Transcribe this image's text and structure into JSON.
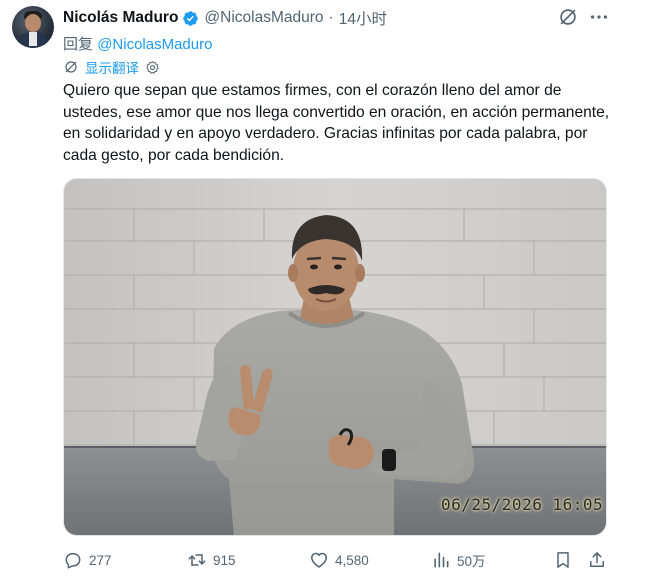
{
  "author": {
    "name": "Nicolás Maduro",
    "handle": "@NicolasMaduro",
    "separator": "·",
    "time": "14小时"
  },
  "reply": {
    "prefix": "回复",
    "mention": "@NicolasMaduro"
  },
  "translate": {
    "label": "显示翻译"
  },
  "tweet": {
    "text": "Quiero que sepan que estamos firmes, con el corazón lleno del amor de ustedes, ese amor que nos llega convertido en oración, en acción permanente, en solidaridad y en apoyo verdadero. Gracias infinitas por cada palabra, por cada gesto, por cada bendición."
  },
  "media": {
    "timestamp": "06/25/2026 16:05"
  },
  "actions": {
    "replies": "277",
    "reposts": "915",
    "likes": "4,580",
    "views": "50万"
  },
  "icons": {
    "verified": "verified-badge-icon",
    "grok": "grok-icon",
    "more": "more-icon",
    "translate": "translate-icon",
    "settings": "gear-icon",
    "reply": "reply-icon",
    "repost": "repost-icon",
    "like": "heart-icon",
    "views": "views-icon",
    "bookmark": "bookmark-icon",
    "share": "share-icon"
  },
  "colors": {
    "accent": "#1d9bf0",
    "secondary_text": "#536471",
    "primary_text": "#0f1419"
  }
}
